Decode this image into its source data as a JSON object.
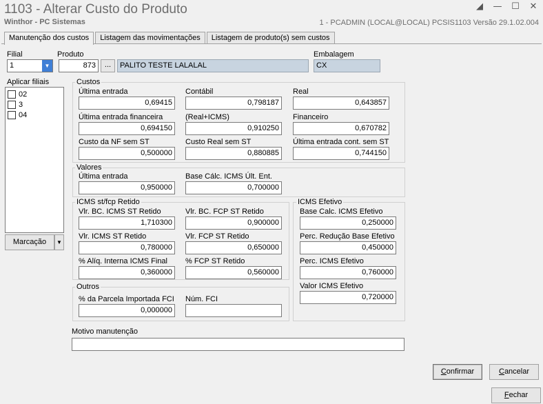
{
  "window": {
    "title": "1103 - Alterar Custo do Produto",
    "subtitle": "Winthor - PC Sistemas",
    "sysinfo": "1 - PCADMIN (LOCAL@LOCAL)   PCSIS1103  Versão  29.1.02.004"
  },
  "tabs": [
    {
      "label": "Manutenção dos custos"
    },
    {
      "label": "Listagem das movimentações"
    },
    {
      "label": "Listagem de produto(s)  sem custos"
    }
  ],
  "filial": {
    "label": "Filial",
    "value": "1"
  },
  "produto": {
    "label": "Produto",
    "code": "873",
    "browse": "...",
    "description": "PALITO TESTE LALALAL"
  },
  "embalagem": {
    "label": "Embalagem",
    "value": "CX"
  },
  "aplicar_filiais": {
    "label": "Aplicar filiais",
    "items": [
      "02",
      "3",
      "04"
    ]
  },
  "marcacao": {
    "label": "Marcação"
  },
  "custos": {
    "title": "Custos",
    "ultima_entrada": {
      "label": "Última entrada",
      "value": "0,69415"
    },
    "contabil": {
      "label": "Contábil",
      "value": "0,798187"
    },
    "real": {
      "label": "Real",
      "value": "0,643857"
    },
    "ultima_entrada_fin": {
      "label": "Última entrada financeira",
      "value": "0,694150"
    },
    "real_icms": {
      "label": "(Real+ICMS)",
      "value": "0,910250"
    },
    "financeiro": {
      "label": "Financeiro",
      "value": "0,670782"
    },
    "custo_nf_sem_st": {
      "label": "Custo da NF sem ST",
      "value": "0,500000"
    },
    "custo_real_sem_st": {
      "label": "Custo Real sem ST",
      "value": "0,880885"
    },
    "ultima_entrada_cont_sem_st": {
      "label": "Última entrada cont. sem ST",
      "value": "0,744150"
    }
  },
  "valores": {
    "title": "Valores",
    "ultima_entrada": {
      "label": "Última entrada",
      "value": "0,950000"
    },
    "base_calc_icms": {
      "label": "Base Cálc. ICMS Últ. Ent.",
      "value": "0,700000"
    }
  },
  "icms_st": {
    "title": "ICMS st/fcp Retido",
    "vlr_bc_icms_st": {
      "label": "Vlr. BC. ICMS ST Retido",
      "value": "1,710300"
    },
    "vlr_bc_fcp_st": {
      "label": "Vlr. BC. FCP ST Retido",
      "value": "0,900000"
    },
    "vlr_icms_st": {
      "label": "Vlr. ICMS ST Retido",
      "value": "0,780000"
    },
    "vlr_fcp_st": {
      "label": "Vlr. FCP ST Retido",
      "value": "0,650000"
    },
    "aliq_interna": {
      "label": "% Alíq. Interna ICMS Final",
      "value": "0,360000"
    },
    "fcp_st_retido": {
      "label": "% FCP ST Retido",
      "value": "0,560000"
    }
  },
  "icms_efetivo": {
    "title": "ICMS Efetivo",
    "base_calc": {
      "label": "Base Calc. ICMS Efetivo",
      "value": "0,250000"
    },
    "perc_reducao": {
      "label": "Perc. Redução Base Efetivo",
      "value": "0,450000"
    },
    "perc_icms": {
      "label": "Perc. ICMS Efetivo",
      "value": "0,760000"
    },
    "valor_icms": {
      "label": "Valor ICMS Efetivo",
      "value": "0,720000"
    }
  },
  "outros": {
    "title": "Outros",
    "parcela_importada": {
      "label": "% da Parcela Importada FCI",
      "value": "0,000000"
    },
    "num_fci": {
      "label": "Núm. FCI",
      "value": ""
    }
  },
  "motivo": {
    "label": "Motivo manutenção",
    "value": ""
  },
  "buttons": {
    "confirmar": {
      "first": "C",
      "rest": "onfirmar"
    },
    "cancelar": {
      "first": "C",
      "rest": "ancelar"
    },
    "fechar": {
      "first": "F",
      "rest": "echar"
    }
  }
}
